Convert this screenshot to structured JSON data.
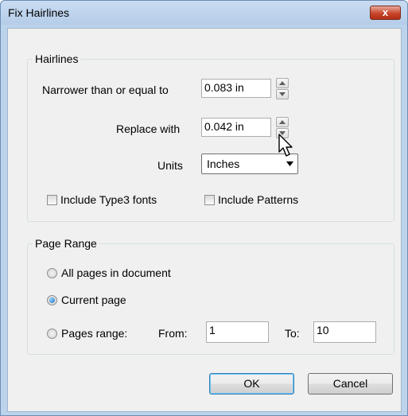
{
  "window": {
    "title": "Fix Hairlines",
    "close_label": "x"
  },
  "hairlines": {
    "legend": "Hairlines",
    "narrower_label": "Narrower than or equal to",
    "narrower_value": "0.083 in",
    "replace_label": "Replace with",
    "replace_value": "0.042 in",
    "units_label": "Units",
    "units_value": "Inches",
    "type3_label": "Include Type3 fonts",
    "patterns_label": "Include Patterns"
  },
  "page_range": {
    "legend": "Page Range",
    "all_pages": "All pages in document",
    "current_page": "Current page",
    "pages_range": "Pages range:",
    "from_label": "From:",
    "from_value": "1",
    "to_label": "To:",
    "to_value": "10",
    "selected": "Current page"
  },
  "buttons": {
    "ok": "OK",
    "cancel": "Cancel"
  }
}
